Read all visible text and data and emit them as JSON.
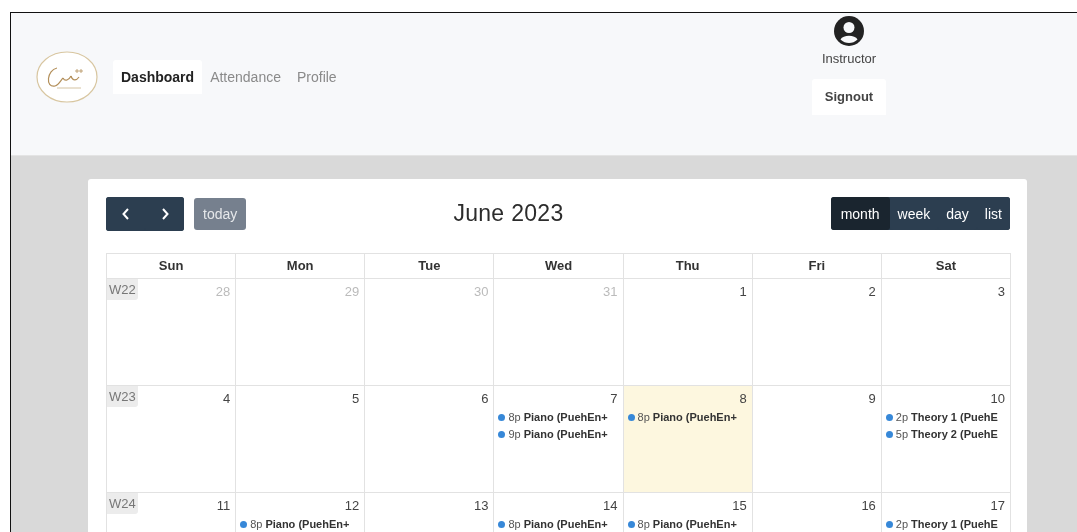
{
  "nav": {
    "tabs": [
      {
        "label": "Dashboard",
        "selected": true
      },
      {
        "label": "Attendance",
        "selected": false
      },
      {
        "label": "Profile",
        "selected": false
      }
    ]
  },
  "user": {
    "role": "Instructor",
    "signout": "Signout"
  },
  "calendar": {
    "title": "June 2023",
    "today_button": {
      "label": "today",
      "disabled": true
    },
    "views": [
      {
        "label": "month",
        "selected": true
      },
      {
        "label": "week",
        "selected": false
      },
      {
        "label": "day",
        "selected": false
      },
      {
        "label": "list",
        "selected": false
      }
    ],
    "weekdays": [
      "Sun",
      "Mon",
      "Tue",
      "Wed",
      "Thu",
      "Fri",
      "Sat"
    ],
    "weeks": [
      {
        "label": "W22",
        "days": [
          {
            "date": "28",
            "other_month": true,
            "today": false
          },
          {
            "date": "29",
            "other_month": true,
            "today": false
          },
          {
            "date": "30",
            "other_month": true,
            "today": false
          },
          {
            "date": "31",
            "other_month": true,
            "today": false
          },
          {
            "date": "1",
            "other_month": false,
            "today": false
          },
          {
            "date": "2",
            "other_month": false,
            "today": false
          },
          {
            "date": "3",
            "other_month": false,
            "today": false
          }
        ]
      },
      {
        "label": "W23",
        "days": [
          {
            "date": "4",
            "other_month": false,
            "today": false
          },
          {
            "date": "5",
            "other_month": false,
            "today": false
          },
          {
            "date": "6",
            "other_month": false,
            "today": false
          },
          {
            "date": "7",
            "other_month": false,
            "today": false,
            "events": [
              {
                "time": "8p",
                "title": "Piano (PuehEn+"
              },
              {
                "time": "9p",
                "title": "Piano (PuehEn+"
              }
            ]
          },
          {
            "date": "8",
            "other_month": false,
            "today": true,
            "events": [
              {
                "time": "8p",
                "title": "Piano (PuehEn+"
              }
            ]
          },
          {
            "date": "9",
            "other_month": false,
            "today": false
          },
          {
            "date": "10",
            "other_month": false,
            "today": false,
            "events": [
              {
                "time": "2p",
                "title": "Theory 1 (PuehE"
              },
              {
                "time": "5p",
                "title": "Theory 2 (PuehE"
              }
            ]
          }
        ]
      },
      {
        "label": "W24",
        "days": [
          {
            "date": "11",
            "other_month": false,
            "today": false
          },
          {
            "date": "12",
            "other_month": false,
            "today": false,
            "events": [
              {
                "time": "8p",
                "title": "Piano (PuehEn+"
              }
            ]
          },
          {
            "date": "13",
            "other_month": false,
            "today": false
          },
          {
            "date": "14",
            "other_month": false,
            "today": false,
            "events": [
              {
                "time": "8p",
                "title": "Piano (PuehEn+"
              }
            ]
          },
          {
            "date": "15",
            "other_month": false,
            "today": false,
            "events": [
              {
                "time": "8p",
                "title": "Piano (PuehEn+"
              }
            ]
          },
          {
            "date": "16",
            "other_month": false,
            "today": false
          },
          {
            "date": "17",
            "other_month": false,
            "today": false,
            "events": [
              {
                "time": "2p",
                "title": "Theory 1 (PuehE"
              }
            ]
          }
        ]
      }
    ]
  }
}
